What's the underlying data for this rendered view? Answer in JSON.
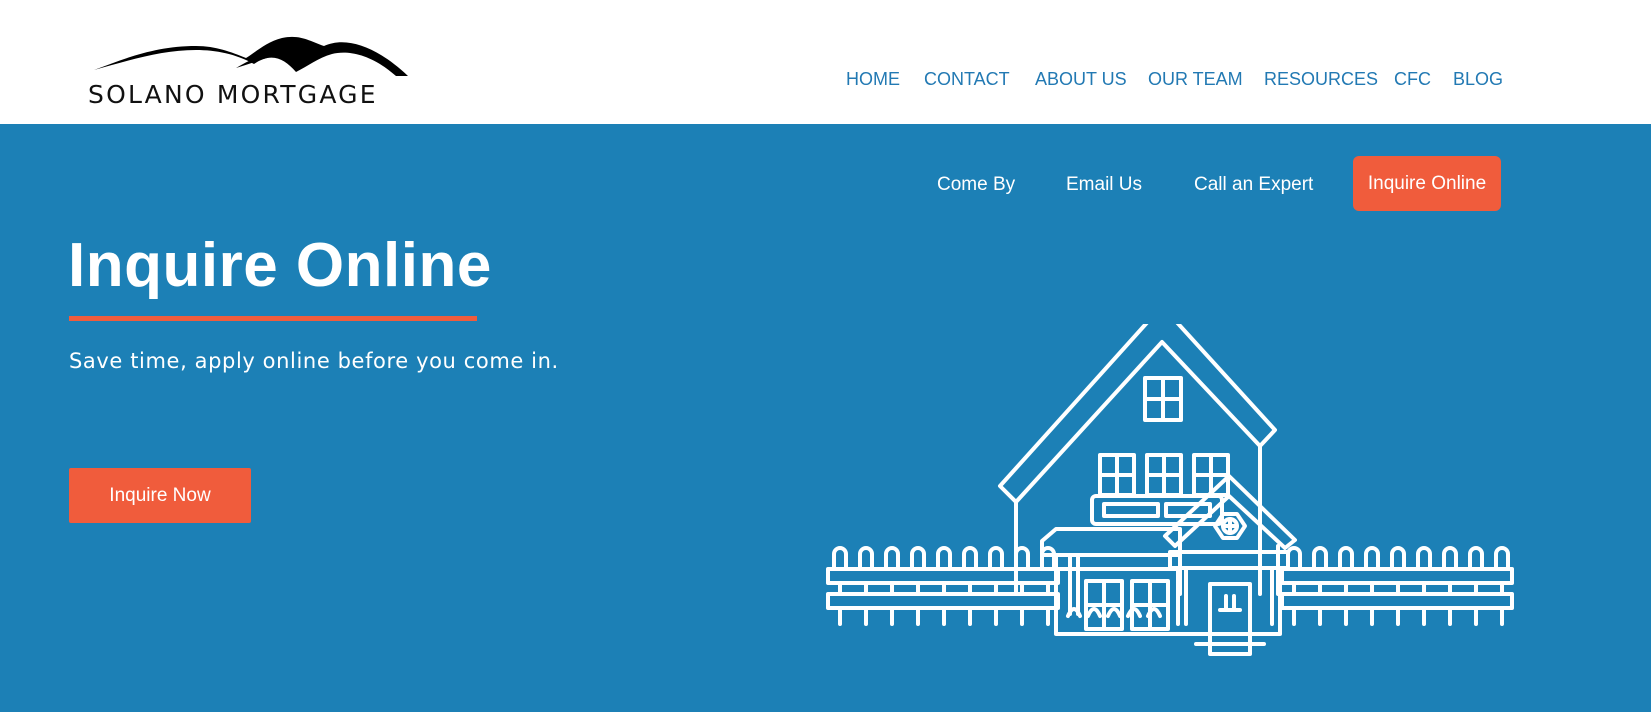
{
  "brand": {
    "logo_text": "SOLANO MORTGAGE",
    "logo_icon": "mountains-logo-icon"
  },
  "main_nav": {
    "items": [
      {
        "label": "HOME"
      },
      {
        "label": "CONTACT"
      },
      {
        "label": "ABOUT US"
      },
      {
        "label": "OUR TEAM"
      },
      {
        "label": "RESOURCES"
      },
      {
        "label": "CFC"
      },
      {
        "label": "BLOG"
      }
    ]
  },
  "contact_nav": {
    "items": [
      {
        "label": "Come By"
      },
      {
        "label": "Email Us"
      },
      {
        "label": "Call an Expert"
      }
    ],
    "cta_label": "Inquire Online"
  },
  "hero": {
    "title": "Inquire Online",
    "subtitle": "Save time, apply online before you come in.",
    "button_label": "Inquire Now",
    "illustration": "house-with-fence-illustration"
  },
  "colors": {
    "primary_blue": "#1c80b6",
    "nav_blue": "#2279b3",
    "accent_orange": "#f05c3c",
    "white": "#ffffff"
  }
}
